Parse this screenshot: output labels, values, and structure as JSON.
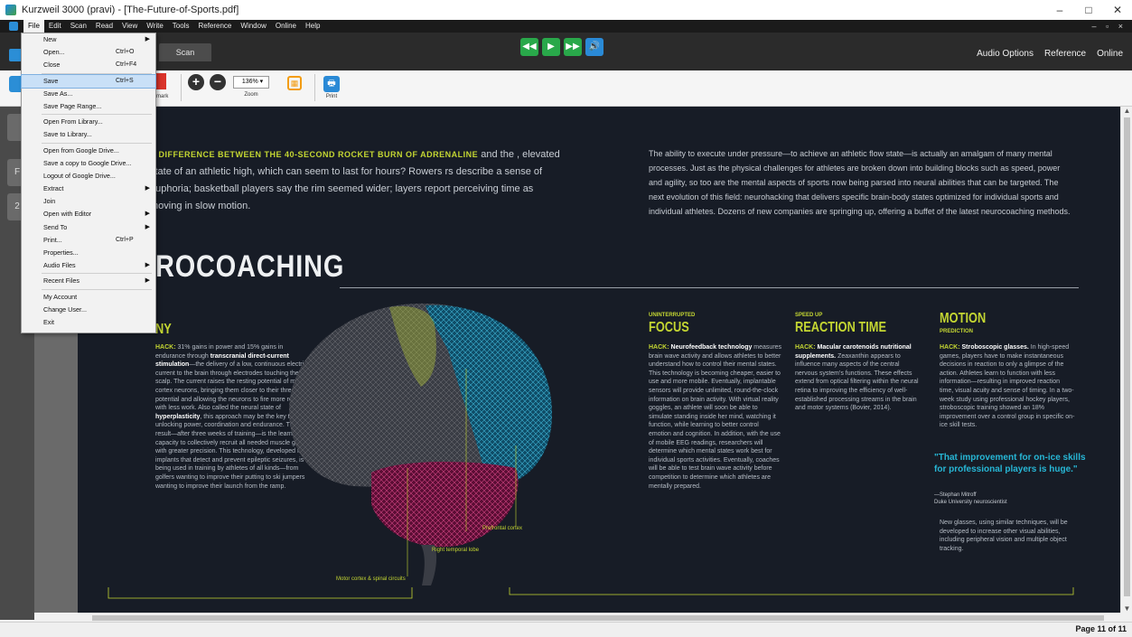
{
  "window": {
    "title": "Kurzweil 3000 (pravi) - [The-Future-of-Sports.pdf]",
    "controls": [
      "–",
      "□",
      "✕"
    ]
  },
  "menubar": [
    "File",
    "Edit",
    "Scan",
    "Read",
    "View",
    "Write",
    "Tools",
    "Reference",
    "Window",
    "Online",
    "Help"
  ],
  "tabs": {
    "scan": "Scan"
  },
  "header_links": [
    "Audio Options",
    "Reference",
    "Online"
  ],
  "toolbar": {
    "bookmark_label": "kmark",
    "zoom_value": "136%",
    "zoom_label": "Zoom",
    "print_label": "Print"
  },
  "file_menu": {
    "items": [
      {
        "label": "New",
        "shortcut": "",
        "submenu": true
      },
      {
        "label": "Open...",
        "shortcut": "Ctrl+O",
        "submenu": false
      },
      {
        "label": "Close",
        "shortcut": "Ctrl+F4",
        "submenu": false
      },
      {
        "label": "Save",
        "shortcut": "Ctrl+S",
        "submenu": false,
        "highlighted": true
      },
      {
        "label": "Save As...",
        "shortcut": "",
        "submenu": false
      },
      {
        "label": "Save Page Range...",
        "shortcut": "",
        "submenu": false
      },
      {
        "label": "Open From Library...",
        "shortcut": "",
        "submenu": false
      },
      {
        "label": "Save to Library...",
        "shortcut": "",
        "submenu": false
      },
      {
        "label": "Open from Google Drive...",
        "shortcut": "",
        "submenu": false
      },
      {
        "label": "Save a copy to Google Drive...",
        "shortcut": "",
        "submenu": false
      },
      {
        "label": "Logout of Google Drive...",
        "shortcut": "",
        "submenu": false
      },
      {
        "label": "Extract",
        "shortcut": "",
        "submenu": true
      },
      {
        "label": "Join",
        "shortcut": "",
        "submenu": false
      },
      {
        "label": "Open with Editor",
        "shortcut": "",
        "submenu": true
      },
      {
        "label": "Send To",
        "shortcut": "",
        "submenu": true
      },
      {
        "label": "Print...",
        "shortcut": "Ctrl+P",
        "submenu": false
      },
      {
        "label": "Properties...",
        "shortcut": "",
        "submenu": false
      },
      {
        "label": "Audio Files",
        "shortcut": "",
        "submenu": true
      },
      {
        "label": "Recent Files",
        "shortcut": "",
        "submenu": true
      },
      {
        "label": "My Account",
        "shortcut": "",
        "submenu": false
      },
      {
        "label": "Change User...",
        "shortcut": "",
        "submenu": false
      },
      {
        "label": "Exit",
        "shortcut": "",
        "submenu": false
      }
    ]
  },
  "document": {
    "intro_lead": "E DIFFERENCE BETWEEN THE 40-SECOND ROCKET BURN OF ADRENALINE",
    "intro_rest": " and the , elevated state of an athletic high, which can seem to last for hours? Rowers rs describe a sense of euphoria; basketball players say the rim seemed wider; layers report perceiving time as moving in slow motion.",
    "right_intro": "The ability to execute under pressure—to achieve an athletic flow state—is actually an amalgam of many mental processes. Just as the physical challenges for athletes are broken down into building blocks such as speed, power and agility, so too are the mental aspects of sports now being parsed into neural abilities that can be targeted. The next evolution of this field: neurohacking that delivers specific brain-body states optimized for individual sports and individual athletes. Dozens of new companies are springing up, offering a buffet of the latest neurocoaching methods.",
    "big_title": "ROCOACHING",
    "stamina": {
      "title": "NY",
      "hack": "HACK:",
      "text_a": " 31% gains in power and 15% gains in endurance through ",
      "bold_a": "transcranial direct-current stimulation",
      "text_b": "—the delivery of a low, continuous electrical current to the brain through electrodes touching the scalp. The current raises the resting potential of motor cortex neurons, bringing them closer to their threshold potential and allowing the neurons to fire more readily, with less work. Also called the neural state of ",
      "bold_b": "hyperplasticity",
      "text_c": ", this approach may be the key to unlocking power, coordination and endurance. The result—after three weeks of training—is the learned capacity to collectively recruit all needed muscle groups with greater precision. This technology, developed from implants that detect and prevent epileptic seizures, is being used in training by athletes of all kinds—from golfers wanting to improve their putting to ski jumpers wanting to improve their launch from the ramp."
    },
    "focus": {
      "kicker": "UNINTERRUPTED",
      "title": "FOCUS",
      "hack": "HACK:",
      "bold": " Neurofeedback technology",
      "text": " measures brain wave activity and allows athletes to better understand how to control their mental states. This technology is becoming cheaper, easier to use and more mobile. Eventually, implantable sensors will provide unlimited, round-the-clock information on brain activity. With virtual reality goggles, an athlete will soon be able to simulate standing inside her mind, watching it function, while learning to better control emotion and cognition. In addition, with the use of mobile EEG readings, researchers will determine which mental states work best for individual sports activities. Eventually, coaches will be able to test brain wave activity before competition to determine which athletes are mentally prepared."
    },
    "reaction": {
      "kicker": "SPEED UP",
      "title": "REACTION TIME",
      "hack": "HACK:",
      "bold": " Macular carotenoids nutritional supplements.",
      "text": " Zeaxanthin appears to influence many aspects of the central nervous system's functions. These effects extend from optical filtering within the neural retina to improving the efficiency of well-established processing streams in the brain and motor systems (Bovier, 2014)."
    },
    "motion": {
      "title": "MOTION",
      "kicker": "PREDICTION",
      "hack": "HACK:",
      "bold": " Stroboscopic glasses.",
      "text": " In high-speed games, players have to make instantaneous decisions in reaction to only a glimpse of the action. Athletes learn to function with less information—resulting in improved reaction time, visual acuity and sense of timing. In a two-week study using professional hockey players, stroboscopic training showed an 18% improvement over a control group in specific on-ice skill tests.",
      "quote": "\"That improvement for on-ice skills for professional players is huge.\"",
      "attrib_name": "—Stephan Mitroff",
      "attrib_org": "Duke University neuroscientist",
      "after": "New glasses, using similar techniques, will be developed to increase other visual abilities, including peripheral vision and multiple object tracking."
    },
    "brain_labels": {
      "prefrontal": "Prefrontal cortex",
      "temporal": "Right temporal lobe",
      "motor": "Motor cortex & spinal circuits"
    }
  },
  "status": {
    "page": "Page 11 of 11"
  },
  "colors": {
    "accent_green": "#c4d632",
    "accent_cyan": "#27b7d6",
    "brain_pink": "#c2185b",
    "brain_blue": "#1fa0c8"
  }
}
